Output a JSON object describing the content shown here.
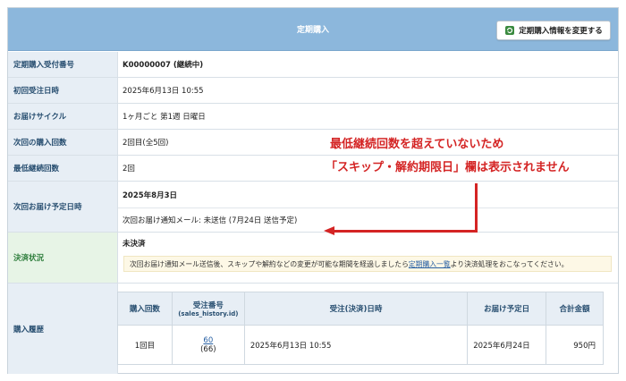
{
  "header": {
    "title": "定期購入",
    "edit_button_label": "定期購入情報を変更する"
  },
  "rows": {
    "order_number": {
      "label": "定期購入受付番号",
      "value": "K00000007 (継続中)"
    },
    "first_order_date": {
      "label": "初回受注日時",
      "value": "2025年6月13日 10:55"
    },
    "delivery_cycle": {
      "label": "お届けサイクル",
      "value": "1ヶ月ごと 第1週 日曜日"
    },
    "next_purchase_count": {
      "label": "次回の購入回数",
      "value": "2回目(全5回)"
    },
    "min_continuation": {
      "label": "最低継続回数",
      "value": "2回"
    },
    "next_delivery": {
      "label": "次回お届け予定日時",
      "date": "2025年8月3日",
      "mail_note": "次回お届け通知メール: 未送信 (7月24日 送信予定)"
    },
    "payment_status": {
      "label": "決済状況",
      "value": "未決済",
      "notice_before": "次回お届け通知メール送信後、スキップや解約などの変更が可能な期間を経過しましたら",
      "notice_link": "定期購入一覧",
      "notice_after": "より決済処理をおこなってください。"
    },
    "purchase_history": {
      "label": "購入履歴"
    }
  },
  "history": {
    "headers": {
      "count": "購入回数",
      "order_no": "受注番号",
      "order_no_sub": "(sales_history.id)",
      "datetime": "受注(決済)日時",
      "delivery_date": "お届け予定日",
      "total": "合計金額"
    },
    "rows": [
      {
        "count": "1回目",
        "order_no": "60",
        "order_sub": "(66)",
        "datetime": "2025年6月13日 10:55",
        "delivery_date": "2025年6月24日",
        "total": "950円"
      }
    ]
  },
  "annotation": {
    "line1": "最低継続回数を超えていないため",
    "line2": "「スキップ・解約期限日」欄は表示されません"
  },
  "colors": {
    "header_bg": "#8cb7dc",
    "label_bg": "#e7eef5",
    "label_green_bg": "#e7f4e6",
    "annotation_red": "#d42424",
    "link_blue": "#2760a3"
  },
  "icons": {
    "edit_button": "refresh-edit-icon"
  }
}
